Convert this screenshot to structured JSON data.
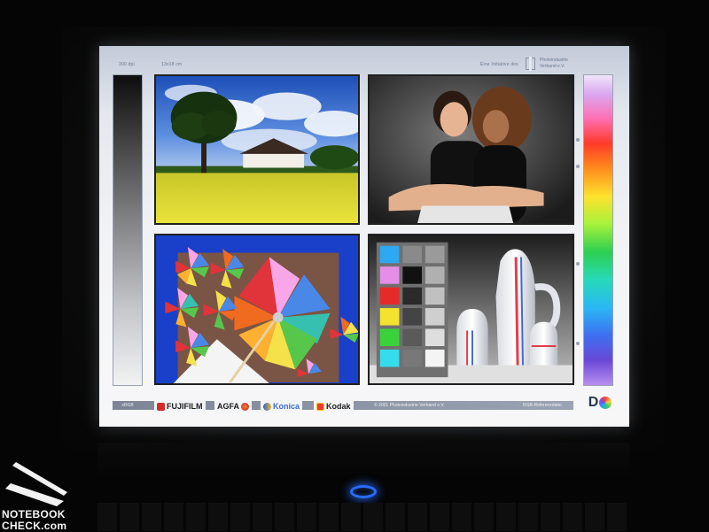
{
  "screen": {
    "header": {
      "dpi": "300 dpi",
      "size": "13x18 cm",
      "initiative": "Eine Initiative des",
      "verband_line1": "Photoindustrie",
      "verband_line2": "Verband e.V."
    },
    "photos": [
      {
        "name": "landscape-photo",
        "icon": "landscape-tree-field"
      },
      {
        "name": "portrait-photo",
        "icon": "two-women-portrait"
      },
      {
        "name": "pinwheels-photo",
        "icon": "pinwheels"
      },
      {
        "name": "ceramics-colorchart-photo",
        "icon": "ceramic-jugs-color-patches"
      }
    ],
    "footer": {
      "srgb": "sRGB",
      "brands": [
        "FUJIFILM",
        "AGFA",
        "Konica",
        "Kodak"
      ],
      "copyright": "© 2001 Photoindustrie-Verband e.V.",
      "reference": "RGB-Referenzdatei",
      "logo": "DQ"
    }
  },
  "watermark": {
    "line1": "NOTEBOOK",
    "line2": "CHECK.com"
  },
  "colors": {
    "power_led": "#2a6cff",
    "screen_bg": "#f3f4f6"
  }
}
